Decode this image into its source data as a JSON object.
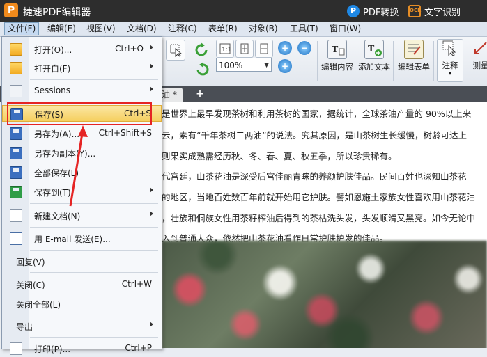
{
  "app": {
    "title": "捷速PDF编辑器",
    "logo_letter": "P"
  },
  "title_actions": {
    "pdf_convert": "PDF转换",
    "ocr": "文字识别",
    "ocr_badge": "OCR",
    "pdf_badge": "P"
  },
  "menubar": [
    "文件(F)",
    "编辑(E)",
    "视图(V)",
    "文档(D)",
    "注释(C)",
    "表单(R)",
    "对象(B)",
    "工具(T)",
    "窗口(W)"
  ],
  "toolbar": {
    "zoom": "100%",
    "zoom_caret": "▼",
    "zoom_in": "+",
    "zoom_out": "−",
    "buttons": [
      "编辑内容",
      "添加文本",
      "编辑表单",
      "注释",
      "测量"
    ]
  },
  "tab": {
    "name": "油 *",
    "add": "+"
  },
  "document": {
    "lines": [
      "是世界上最早发现茶树和利用茶树的国家，据统计，全球茶油产量的 90%以上来",
      "云，素有“千年茶树二两油”的说法。究其原因，是山茶树生长缓慢，树龄可达上",
      "则果实成熟需经历秋、冬、春、夏、秋五季，所以珍贵稀有。",
      "代宫廷，山茶花油是深受后宫佳丽青睐的养颜护肤佳品。民间百姓也深知山茶花",
      "的地区，当地百姓数百年前就开始用它护肤。譬如恩施土家族女性喜欢用山茶花油",
      "，壮族和侗族女性用茶籽榨油后得到的茶枯洗头发，头发顺滑又黑亮。如今无论中",
      "入到普通大众，依然把山茶花油看作日常护肤护发的佳品。"
    ]
  },
  "file_menu": {
    "items": [
      {
        "label": "打开(O)...",
        "shortcut": "Ctrl+O",
        "submenu": true,
        "icon": "folder-icon"
      },
      {
        "label": "打开自(F)",
        "shortcut": "",
        "submenu": true,
        "icon": "folder-icon"
      },
      {
        "label": "Sessions",
        "shortcut": "",
        "submenu": true,
        "icon": "sessions-icon"
      },
      {
        "label": "保存(S)",
        "shortcut": "Ctrl+S",
        "submenu": false,
        "icon": "save-icon"
      },
      {
        "label": "另存为(A)...",
        "shortcut": "Ctrl+Shift+S",
        "submenu": false,
        "icon": "save-as-icon"
      },
      {
        "label": "另存为副本(Y)...",
        "shortcut": "",
        "submenu": false,
        "icon": "save-copy-icon"
      },
      {
        "label": "全部保存(L)",
        "shortcut": "",
        "submenu": false,
        "icon": "save-all-icon"
      },
      {
        "label": "保存到(T)",
        "shortcut": "",
        "submenu": true,
        "icon": "save-to-icon"
      },
      {
        "label": "新建文档(N)",
        "shortcut": "",
        "submenu": true,
        "icon": "new-document-icon"
      },
      {
        "label": "用 E-mail 发送(E)...",
        "shortcut": "",
        "submenu": false,
        "icon": "email-icon"
      },
      {
        "label": "回复(V)",
        "shortcut": "",
        "submenu": false,
        "icon": ""
      },
      {
        "label": "关闭(C)",
        "shortcut": "Ctrl+W",
        "submenu": false,
        "icon": ""
      },
      {
        "label": "关闭全部(L)",
        "shortcut": "",
        "submenu": false,
        "icon": ""
      },
      {
        "label": "导出",
        "shortcut": "",
        "submenu": true,
        "icon": ""
      },
      {
        "label": "打印(P)...",
        "shortcut": "Ctrl+P",
        "submenu": false,
        "icon": "print-icon"
      }
    ]
  },
  "colors": {
    "highlight": "#f5cf5f",
    "annotation": "#e52424",
    "titlebar": "#2d2d2d"
  }
}
